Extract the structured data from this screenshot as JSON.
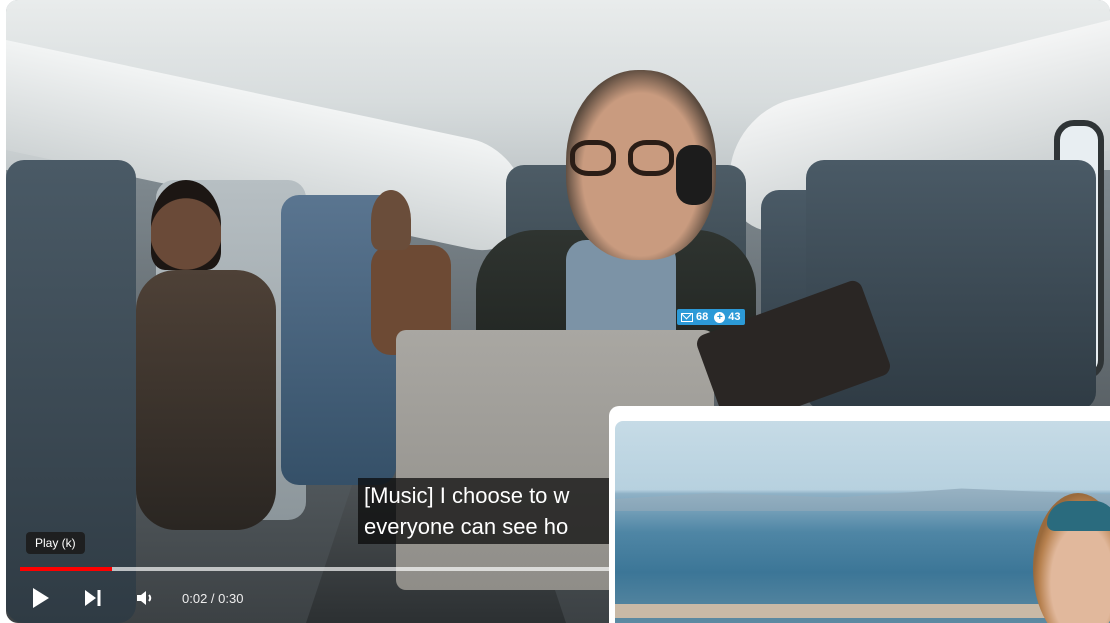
{
  "player": {
    "title": "",
    "badge": {
      "mail_count": "68",
      "plus_count": "43"
    },
    "captions": {
      "line1": "[Music] I choose to w",
      "line2": "everyone can see ho"
    },
    "tooltip": "Play (k)",
    "time": {
      "current": "0:02",
      "separator": " / ",
      "total": "0:30"
    },
    "progress": {
      "played_fraction": 0.085,
      "buffered_fraction": 0.55
    },
    "colors": {
      "progress_played": "#ff0000",
      "badge": "#2c9ad7"
    },
    "icons": {
      "play": "play-icon",
      "next": "next-icon",
      "volume": "volume-icon"
    }
  }
}
